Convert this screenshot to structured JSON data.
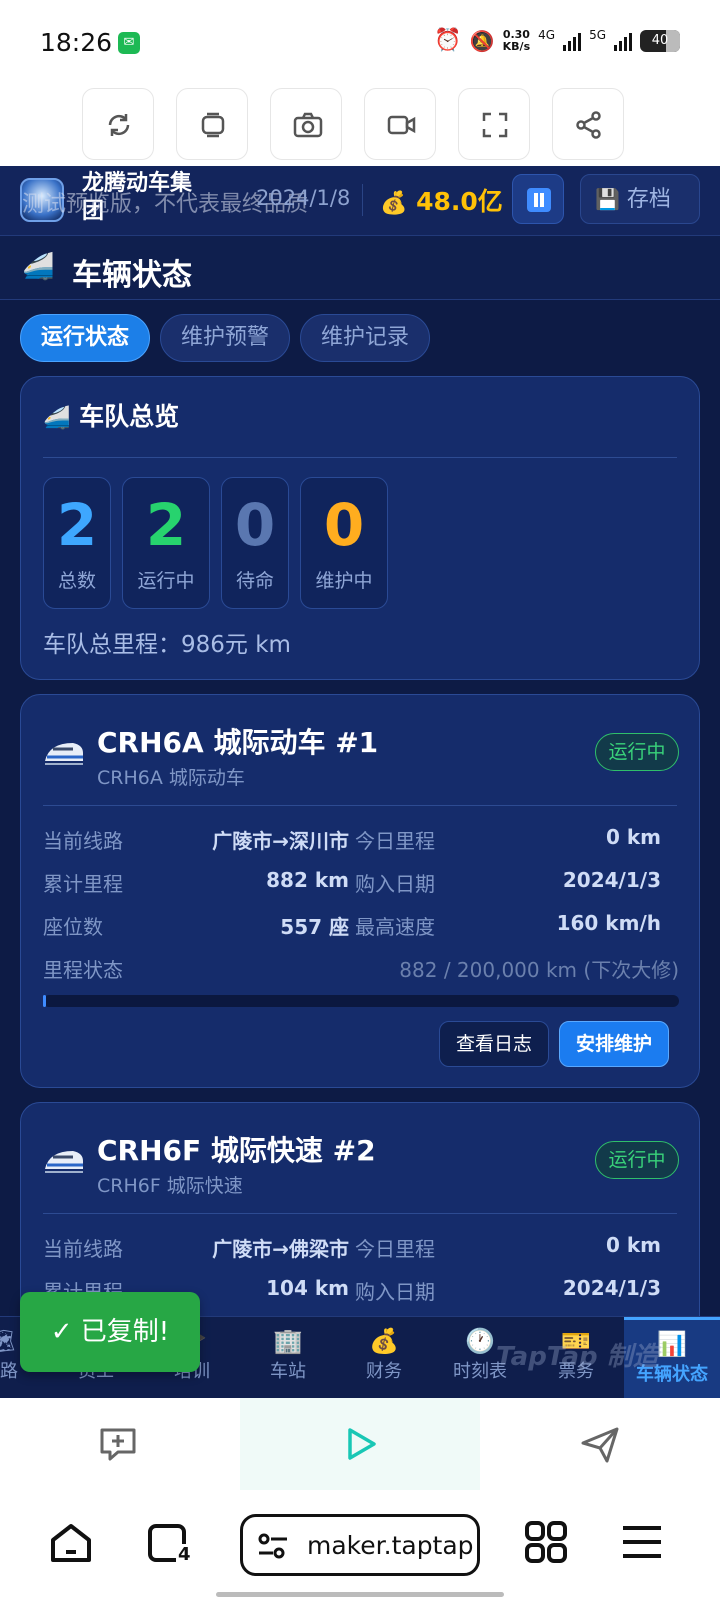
{
  "status_bar": {
    "time": "18:26",
    "net_speed_value": "0.30",
    "net_speed_unit": "KB/s",
    "sim1": "4G",
    "sim2": "5G",
    "battery": "40"
  },
  "top_toolbar": {
    "icons": [
      "refresh-icon",
      "copy-window-icon",
      "camera-icon",
      "video-icon",
      "fullscreen-icon",
      "share-icon"
    ]
  },
  "header": {
    "company": "龙腾动车集团",
    "watermark": "测试预览版，不代表最终品质",
    "date": "2024/1/8",
    "money_icon": "💰",
    "money": "48.0亿",
    "save_label": "存档",
    "save_icon": "💾"
  },
  "page": {
    "title_icon": "🚄",
    "title": "车辆状态"
  },
  "tabs": [
    {
      "label": "运行状态",
      "active": true
    },
    {
      "label": "维护预警",
      "active": false
    },
    {
      "label": "维护记录",
      "active": false
    }
  ],
  "overview": {
    "icon": "🚄",
    "title": "车队总览",
    "stats": [
      {
        "value": "2",
        "label": "总数",
        "color": "#3ea7ff"
      },
      {
        "value": "2",
        "label": "运行中",
        "color": "#27d36e"
      },
      {
        "value": "0",
        "label": "待命",
        "color": "#5a77b0"
      },
      {
        "value": "0",
        "label": "维护中",
        "color": "#ffad1f"
      }
    ],
    "total_label": "车队总里程：",
    "total_value": "986元 km"
  },
  "trains": [
    {
      "name": "CRH6A 城际动车 #1",
      "model": "CRH6A 城际动车",
      "status": "运行中",
      "route_label": "当前线路",
      "route": "广陵市→深川市",
      "today_label": "今日里程",
      "today": "0 km",
      "total_label": "累计里程",
      "total": "882 km",
      "buy_label": "购入日期",
      "buy": "2024/1/3",
      "seats_label": "座位数",
      "seats": "557 座",
      "speed_label": "最高速度",
      "speed": "160 km/h",
      "mileage_label": "里程状态",
      "mileage": "882 / 200,000 km (下次大修)",
      "mileage_fraction": 0.0044,
      "log_label": "查看日志",
      "maint_label": "安排维护"
    },
    {
      "name": "CRH6F 城际快速 #2",
      "model": "CRH6F 城际快速",
      "status": "运行中",
      "route_label": "当前线路",
      "route": "广陵市→佛梁市",
      "today_label": "今日里程",
      "today": "0 km",
      "total_label": "累计里程",
      "total": "104 km",
      "buy_label": "购入日期",
      "buy": "2024/1/3"
    }
  ],
  "bottom_nav": [
    {
      "label": "线路",
      "icon": "🗺",
      "active": false
    },
    {
      "label": "员工",
      "icon": "👥",
      "active": false
    },
    {
      "label": "培训",
      "icon": "🎓",
      "active": false
    },
    {
      "label": "车站",
      "icon": "🏢",
      "active": false
    },
    {
      "label": "财务",
      "icon": "💰",
      "active": false
    },
    {
      "label": "时刻表",
      "icon": "🕐",
      "active": false
    },
    {
      "label": "票务",
      "icon": "🎫",
      "active": false
    },
    {
      "label": "车辆状态",
      "icon": "📊",
      "active": true
    }
  ],
  "taptap_watermark": "TapTap 制造",
  "toast": "✓ 已复制!",
  "browser": {
    "url": "maker.taptap",
    "tab_count": "4"
  }
}
